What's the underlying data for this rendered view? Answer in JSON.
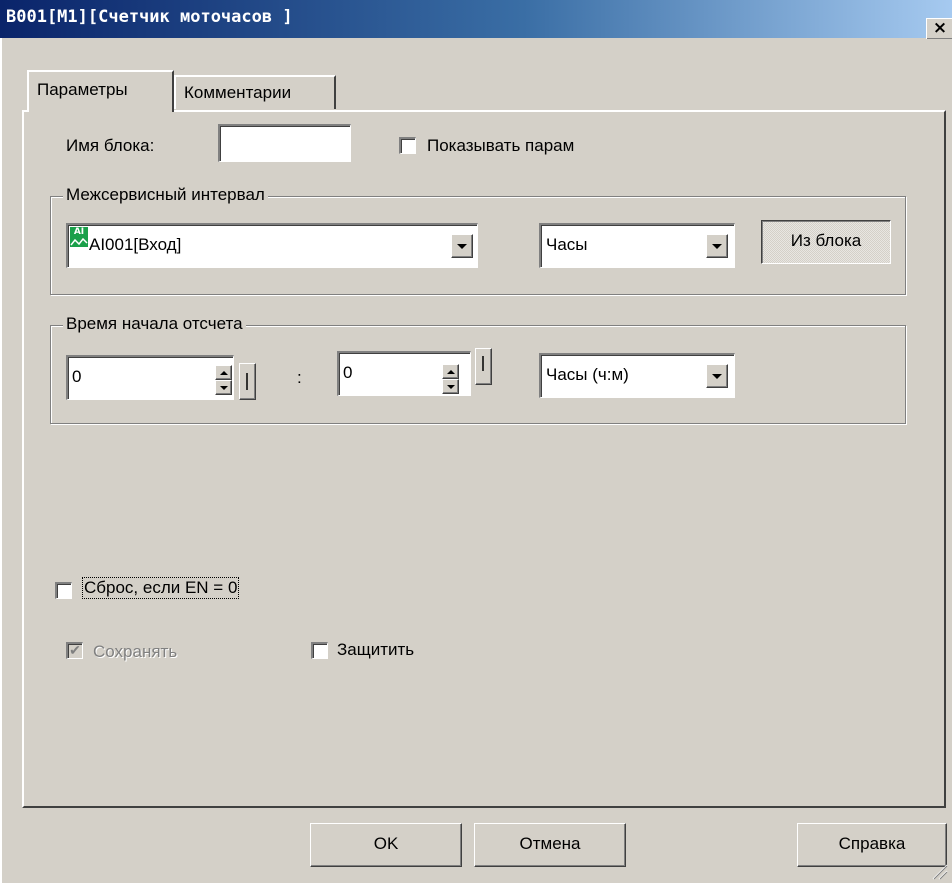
{
  "window": {
    "title": "B001[M1][Счетчик моточасов ]",
    "close_glyph": "×"
  },
  "tabs": [
    {
      "label": "Параметры",
      "active": true
    },
    {
      "label": "Комментарии",
      "active": false
    }
  ],
  "params": {
    "block_name_label": "Имя блока:",
    "block_name_value": "",
    "show_params_label": "Показывать парам",
    "show_params_checked": false,
    "interval_group": {
      "legend": "Межсервисный интервал",
      "source_icon_text": "AI",
      "source_value": "AI001[Вход]",
      "unit_value": "Часы",
      "from_block_label": "Из блока"
    },
    "start_group": {
      "legend": "Время начала отсчета",
      "hours_value": "0",
      "minutes_value": "0",
      "separator": ":",
      "format_value": "Часы (ч:м)"
    },
    "reset_label": "Сброс, если EN = 0",
    "reset_checked": false,
    "retain_label": "Сохранять",
    "retain_checked": true,
    "protect_label": "Защитить",
    "protect_checked": false
  },
  "buttons": {
    "ok": "OK",
    "cancel": "Отмена",
    "help": "Справка"
  },
  "colors": {
    "titlebar_start": "#0a246a",
    "titlebar_end": "#a6caf0",
    "face": "#d4d0c8",
    "ai_icon": "#1aa04a"
  }
}
